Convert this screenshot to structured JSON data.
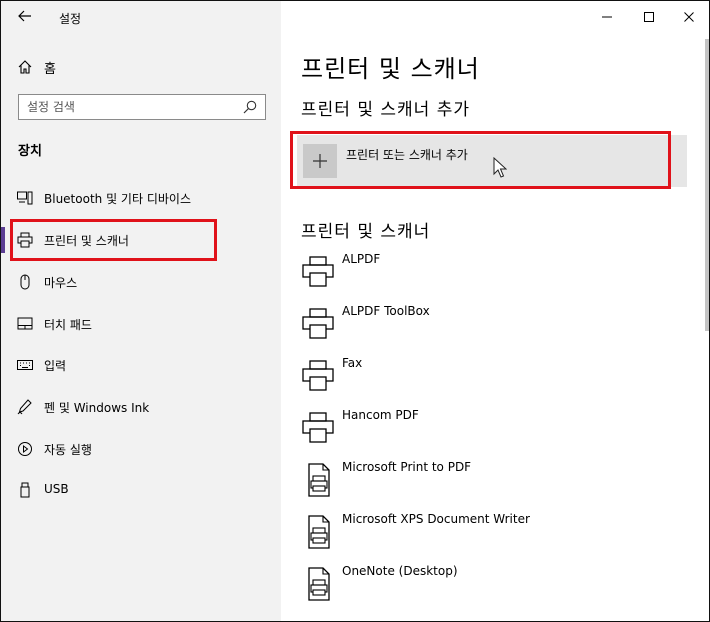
{
  "window": {
    "title": "설정",
    "back_icon": "arrow-left-icon",
    "controls": [
      "minimize-icon",
      "maximize-icon",
      "close-icon"
    ]
  },
  "sidebar": {
    "home_label": "홈",
    "search_placeholder": "설정 검색",
    "section_title": "장치",
    "items": [
      {
        "label": "Bluetooth 및 기타 디바이스",
        "icon": "bluetooth-devices-icon"
      },
      {
        "label": "프린터 및 스캐너",
        "icon": "printer-icon",
        "active": true
      },
      {
        "label": "마우스",
        "icon": "mouse-icon"
      },
      {
        "label": "터치 패드",
        "icon": "touchpad-icon"
      },
      {
        "label": "입력",
        "icon": "keyboard-icon"
      },
      {
        "label": "펜 및 Windows Ink",
        "icon": "pen-icon"
      },
      {
        "label": "자동 실행",
        "icon": "autoplay-icon"
      },
      {
        "label": "USB",
        "icon": "usb-icon"
      }
    ]
  },
  "main": {
    "title": "프린터 및 스캐너",
    "add_section_title": "프린터 및 스캐너 추가",
    "add_button_label": "프린터 또는 스캐너 추가",
    "list_title": "프린터 및 스캐너",
    "printers": [
      {
        "name": "ALPDF",
        "icon": "printer-icon"
      },
      {
        "name": "ALPDF ToolBox",
        "icon": "printer-icon"
      },
      {
        "name": "Fax",
        "icon": "printer-icon"
      },
      {
        "name": "Hancom PDF",
        "icon": "printer-icon"
      },
      {
        "name": "Microsoft Print to PDF",
        "icon": "document-printer-icon"
      },
      {
        "name": "Microsoft XPS Document Writer",
        "icon": "document-printer-icon"
      },
      {
        "name": "OneNote (Desktop)",
        "icon": "document-printer-icon"
      }
    ]
  },
  "colors": {
    "accent": "#5b3d93",
    "highlight": "#e0121a",
    "sidebar_bg": "#f2f2f2"
  }
}
